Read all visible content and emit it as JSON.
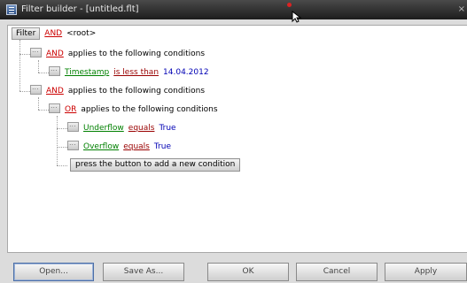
{
  "window": {
    "title": "Filter builder - [untitled.flt]",
    "close_glyph": "×"
  },
  "tree": {
    "root_button": "Filter",
    "root_operator": "AND",
    "root_label": "<root>",
    "group1": {
      "operator": "AND",
      "text": "applies to the following conditions"
    },
    "cond1": {
      "field": "Timestamp",
      "op": "is less than",
      "value": "14.04.2012"
    },
    "group2": {
      "operator": "AND",
      "text": "applies to the following conditions"
    },
    "group3": {
      "operator": "OR",
      "text": "applies to the following conditions"
    },
    "cond2": {
      "field": "Underflow",
      "op": "equals",
      "value": "True"
    },
    "cond3": {
      "field": "Overflow",
      "op": "equals",
      "value": "True"
    },
    "add_condition": "press the button to add a new condition"
  },
  "buttons": {
    "open": "Open...",
    "save_as": "Save As...",
    "ok": "OK",
    "cancel": "Cancel",
    "apply": "Apply"
  },
  "colors": {
    "operator": "#cc0000",
    "field": "#008000",
    "op": "#990000",
    "value": "#0000b4"
  }
}
